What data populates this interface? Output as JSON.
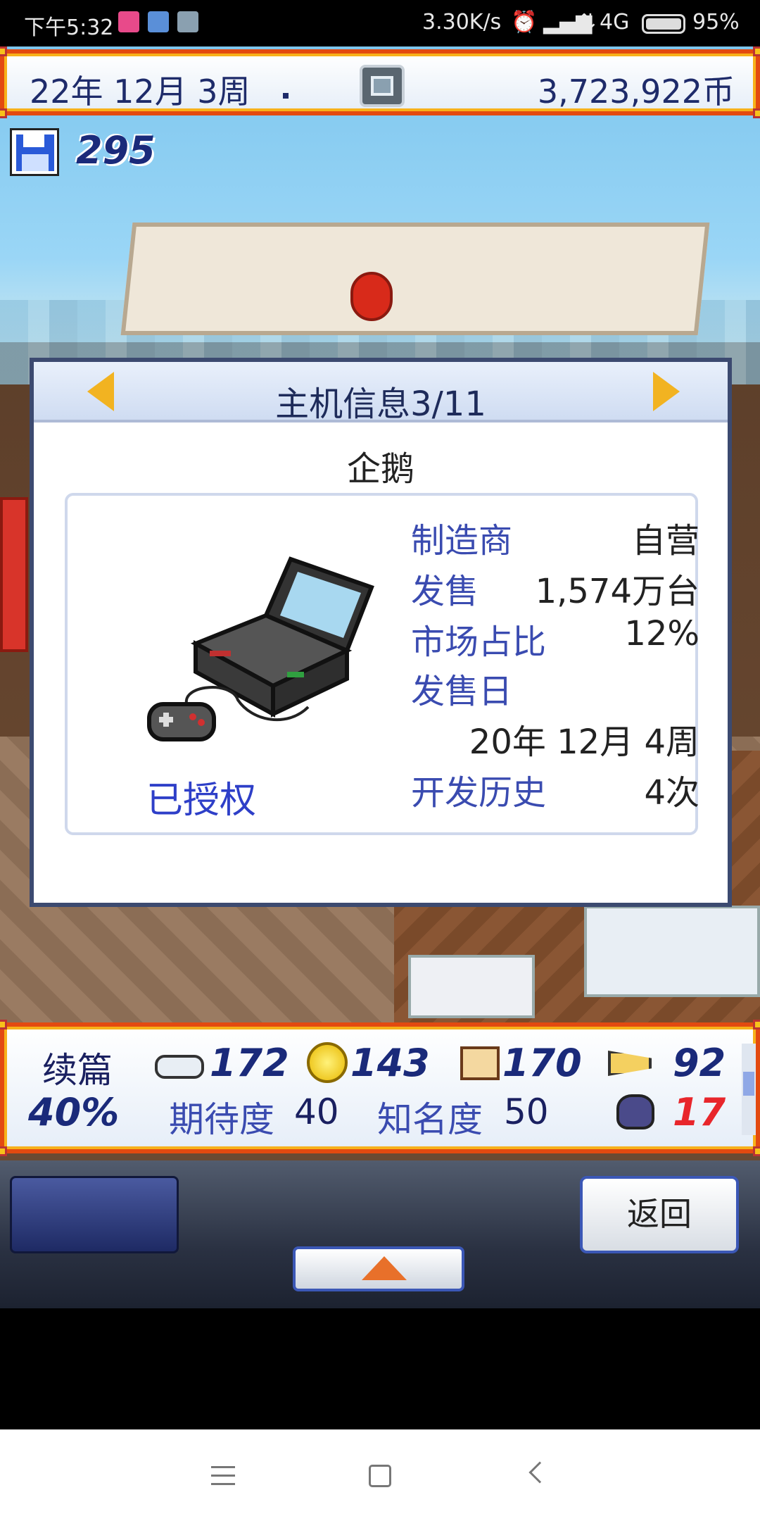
{
  "status_bar": {
    "time": "下午5:32",
    "net_speed": "3.30K/s",
    "network": "4G",
    "battery": "95%"
  },
  "top_bar": {
    "date": "22年 12月 3周",
    "coins": "3,723,922币"
  },
  "save_count": "295",
  "dialog": {
    "title": "主机信息3/11",
    "console_name": "企鹅",
    "licensed": "已授权",
    "rows": [
      {
        "label": "制造商",
        "value": "自营"
      },
      {
        "label": "发售",
        "value": "1,574万台"
      },
      {
        "label": "市场占比",
        "value": "12%"
      },
      {
        "label": "发售日",
        "value": "20年 12月 4周"
      },
      {
        "label": "开发历史",
        "value": "4次"
      }
    ]
  },
  "stats": {
    "sequel_label": "续篇",
    "sequel_percent": "40%",
    "fun": "172",
    "creativity": "143",
    "graphics": "170",
    "sound": "92",
    "bugs": "17",
    "expectation_label": "期待度",
    "expectation_value": "40",
    "fame_label": "知名度",
    "fame_value": "50"
  },
  "controls": {
    "back_label": "返回"
  },
  "colors": {
    "bar_border": "#e34a10",
    "label_blue": "#3a4bb0",
    "bug_red": "#e8262b",
    "stat_navy": "#1a2a7a"
  }
}
